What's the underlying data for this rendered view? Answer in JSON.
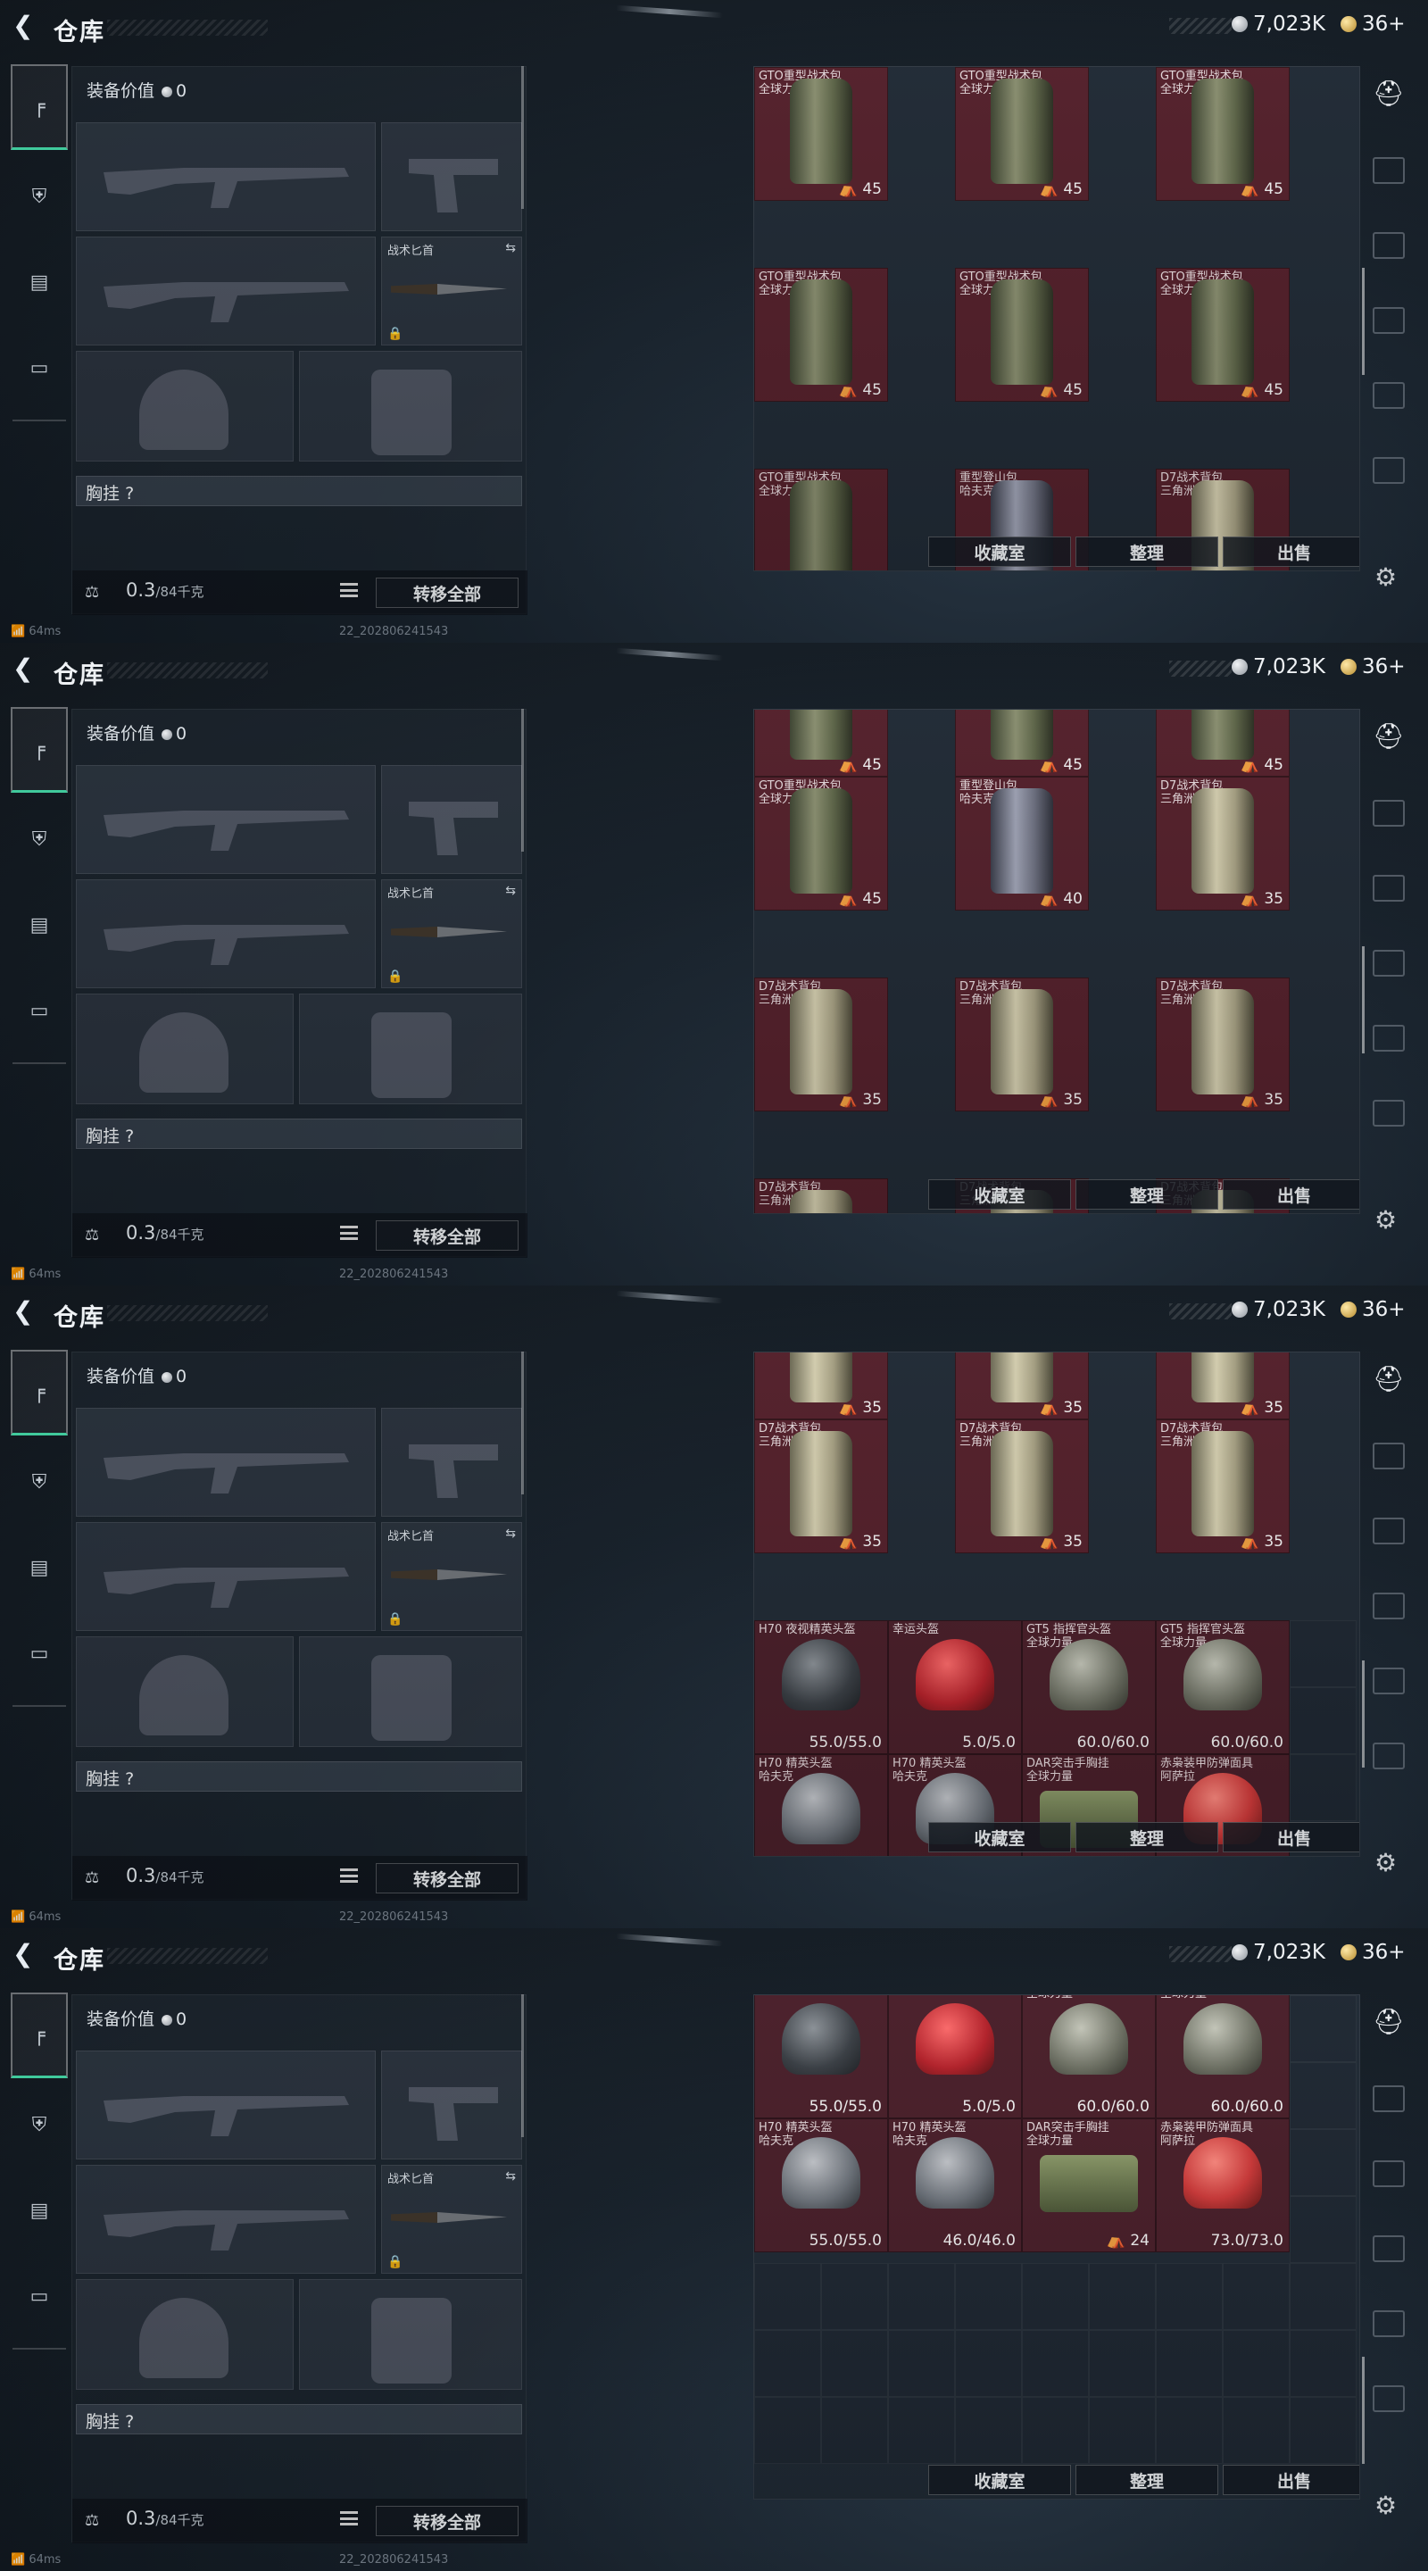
{
  "topbar": {
    "title": "仓库",
    "silver": "7,023K",
    "gold": "36+"
  },
  "loadout": {
    "equip_value_label": "装备价值",
    "equip_value": "0",
    "melee_label": "战术匕首",
    "vest_label": "胸挂",
    "vest_hint": "?",
    "weight": "0.3",
    "weight_max": "/84千克",
    "transfer_all": "转移全部"
  },
  "stash_buttons": {
    "collection": "收藏室",
    "sort": "整理",
    "sell": "出售"
  },
  "status": {
    "ping": "64ms",
    "build": "22_202806241543"
  },
  "icons": {
    "back": "back-arrow-icon",
    "gun_tab": "gun-icon",
    "helmet_tab": "armor-icon",
    "bag_tab": "backpack-icon",
    "case_tab": "briefcase-icon",
    "settings": "gear-icon",
    "lock": "lock-icon"
  },
  "items": {
    "gto": {
      "name": "GTO重型战术包",
      "region": "全球力量",
      "cap": "45"
    },
    "climb": {
      "name": "重型登山包",
      "region": "哈夫克",
      "cap": "40"
    },
    "d7": {
      "name": "D7战术背包",
      "region": "三角洲",
      "cap": "35"
    },
    "h70nv": {
      "name": "H70 夜视精英头盔",
      "dur": "55.0/55.0"
    },
    "luck": {
      "name": "幸运头盔",
      "dur": "5.0/5.0"
    },
    "gt5": {
      "name": "GT5 指挥官头盔",
      "region": "全球力量",
      "dur": "60.0/60.0"
    },
    "h70a": {
      "name": "H70 精英头盔",
      "region": "哈夫克",
      "dur": "55.0/55.0"
    },
    "h70b": {
      "name": "H70 精英头盔",
      "region": "哈夫克",
      "dur": "46.0/46.0"
    },
    "dar": {
      "name": "DAR突击手胸挂",
      "region": "全球力量",
      "cap": "24"
    },
    "owl": {
      "name": "赤枭装甲防弹面具",
      "region": "阿萨拉",
      "dur": "73.0/73.0"
    }
  }
}
